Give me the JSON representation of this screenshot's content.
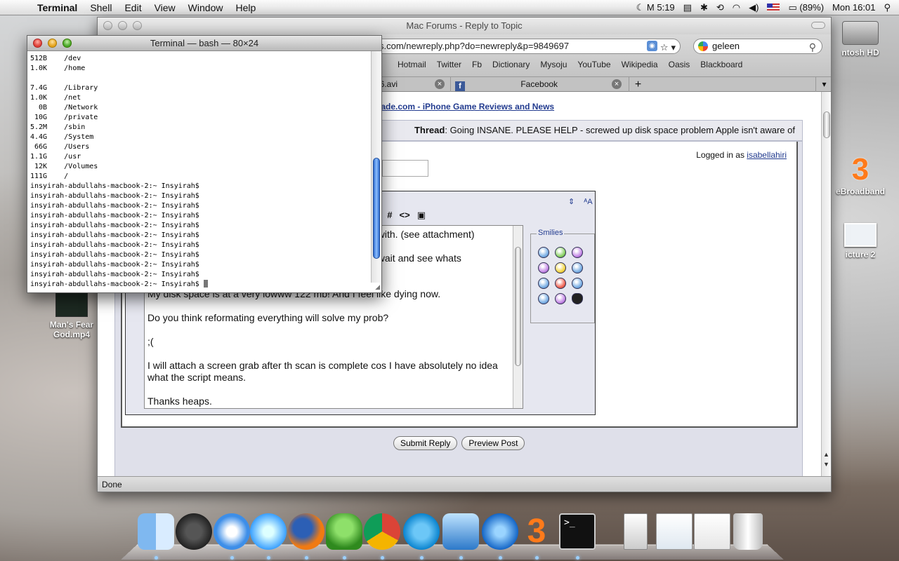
{
  "menubar": {
    "app_name": "Terminal",
    "items": [
      "Shell",
      "Edit",
      "View",
      "Window",
      "Help"
    ],
    "clock_menu": "M 5:19",
    "battery": "(89%)",
    "datetime": "Mon 16:01"
  },
  "desktop": {
    "hd_label": "ntosh HD",
    "broadband_label": "eBroadband",
    "picture_label": "icture 2",
    "video_label_1": "Man's Fear",
    "video_label_2": "God.mp4"
  },
  "browser": {
    "title": "Mac Forums - Reply to Topic",
    "url": "s.com/newreply.php?do=newreply&p=9849697",
    "search_value": "geleen",
    "bookmarks": [
      "Hotmail",
      "Twitter",
      "Fb",
      "Dictionary",
      "Mysoju",
      "YouTube",
      "Wikipedia",
      "Oasis",
      "Blackboard"
    ],
    "tabs": [
      {
        "label": "86.avi"
      },
      {
        "label": "Facebook"
      }
    ],
    "add_tab_label": "+",
    "status": "Done"
  },
  "page": {
    "forum_link": "rcade.com - iPhone Game Reviews and News",
    "thread_prefix": "Thread",
    "thread_title": "Going INSANE. PLEASE HELP - screwed up disk space problem Apple isn't aware of",
    "logged_in_prefix": "Logged in as",
    "username": "isabellahiri",
    "smilies_label": "Smilies",
    "message_lines": [
      "t with. (see attachment)",
      "t wait and see whats",
      "My disk space is at a very lowww 122 mb! And I feel like dying now.",
      "Do you think reformating everything will solve my prob?",
      ";(",
      "I will attach a screen grab after th scan is complete cos I have absolutely no idea what the script means.",
      "Thanks heaps."
    ],
    "submit_label": "Submit Reply",
    "preview_label": "Preview Post"
  },
  "terminal": {
    "title": "Terminal — bash — 80×24",
    "lines": [
      "512B    /dev",
      "1.0K    /home",
      "",
      "7.4G    /Library",
      "1.0K    /net",
      "  0B    /Network",
      " 10G    /private",
      "5.2M    /sbin",
      "4.4G    /System",
      " 66G    /Users",
      "1.1G    /usr",
      " 12K    /Volumes",
      "111G    /",
      "insyirah-abdullahs-macbook-2:~ Insyirah$",
      "insyirah-abdullahs-macbook-2:~ Insyirah$",
      "insyirah-abdullahs-macbook-2:~ Insyirah$",
      "insyirah-abdullahs-macbook-2:~ Insyirah$",
      "insyirah-abdullahs-macbook-2:~ Insyirah$",
      "insyirah-abdullahs-macbook-2:~ Insyirah$",
      "insyirah-abdullahs-macbook-2:~ Insyirah$",
      "insyirah-abdullahs-macbook-2:~ Insyirah$",
      "insyirah-abdullahs-macbook-2:~ Insyirah$",
      "insyirah-abdullahs-macbook-2:~ Insyirah$",
      "insyirah-abdullahs-macbook-2:~ Insyirah$"
    ]
  },
  "dock": {
    "items": [
      "finder-icon",
      "dashboard-icon",
      "safari-icon",
      "itunes-icon",
      "firefox-icon",
      "adium-icon",
      "chrome-icon",
      "skype-icon",
      "preview-icon",
      "downloads-icon",
      "three-broadband-icon",
      "terminal-icon",
      "document-icon",
      "screenshot-icon",
      "downloads-stack-icon",
      "trash-icon"
    ]
  }
}
